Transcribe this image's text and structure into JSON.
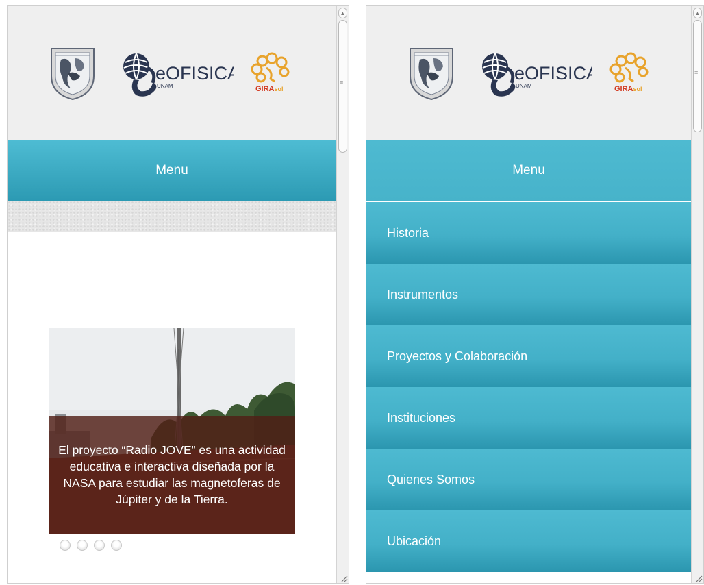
{
  "left": {
    "menu_label": "Menu",
    "slide_caption": "El proyecto “Radio JOVE” es una actividad educativa e interactiva diseñada por la NASA para estudiar las magnetoferas de Júpiter y de la Tierra.",
    "slider_dots": 4
  },
  "right": {
    "menu_label": "Menu",
    "menu_items": [
      "Historia",
      "Instrumentos",
      "Proyectos y Colaboración",
      "Instituciones",
      "Quienes Somos",
      "Ubicación"
    ]
  },
  "logos": {
    "geofisica_main": "eOFISICA",
    "geofisica_sub": "UNAM",
    "girasol_text_a": "GIRA",
    "girasol_text_b": "sol"
  },
  "colors": {
    "menu_accent": "#3aa9c2",
    "header_bg": "#efefef",
    "caption_bg": "#501e16",
    "girasol_orange": "#e8a32c",
    "girasol_red": "#d23a22",
    "geofisica_navy": "#2a3550"
  }
}
